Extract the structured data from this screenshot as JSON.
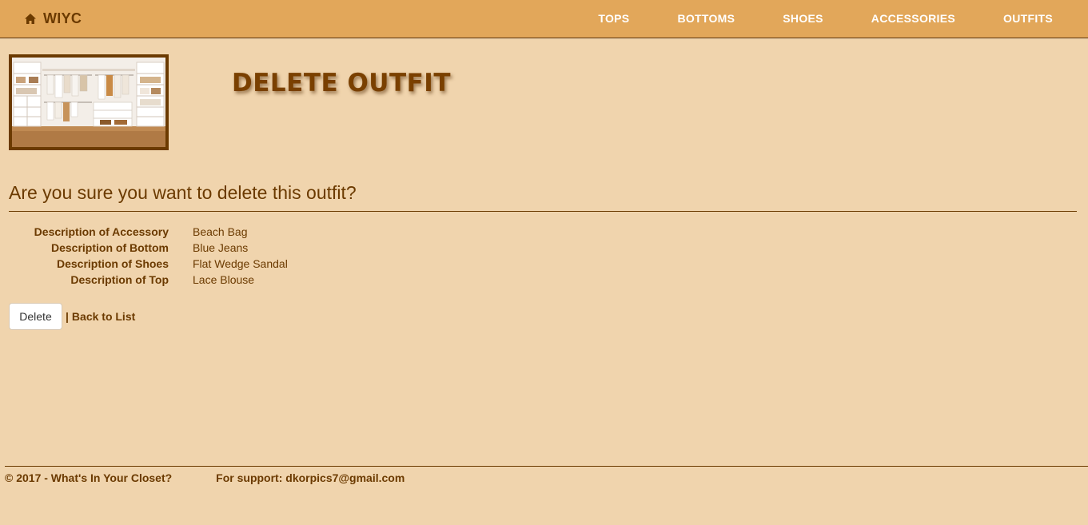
{
  "nav": {
    "brand": "WIYC",
    "brand_icon": "home-icon",
    "links": [
      "TOPS",
      "BOTTOMS",
      "SHOES",
      "ACCESSORIES",
      "OUTFITS"
    ]
  },
  "header": {
    "title": "DELETE OUTFIT"
  },
  "confirm": {
    "question": "Are you sure you want to delete this outfit?"
  },
  "details": [
    {
      "label": "Description of Accessory",
      "value": "Beach Bag"
    },
    {
      "label": "Description of Bottom",
      "value": "Blue Jeans"
    },
    {
      "label": "Description of Shoes",
      "value": "Flat Wedge Sandal"
    },
    {
      "label": "Description of Top",
      "value": "Lace Blouse"
    }
  ],
  "actions": {
    "delete_label": "Delete",
    "separator": "|",
    "back_label": "Back to List"
  },
  "footer": {
    "copyright": "© 2017 - What's In Your Closet?",
    "support": "For support: dkorpics7@gmail.com"
  },
  "colors": {
    "background": "#f0d4ad",
    "navbar": "#e2a75a",
    "accent_brown": "#6b3a00"
  }
}
